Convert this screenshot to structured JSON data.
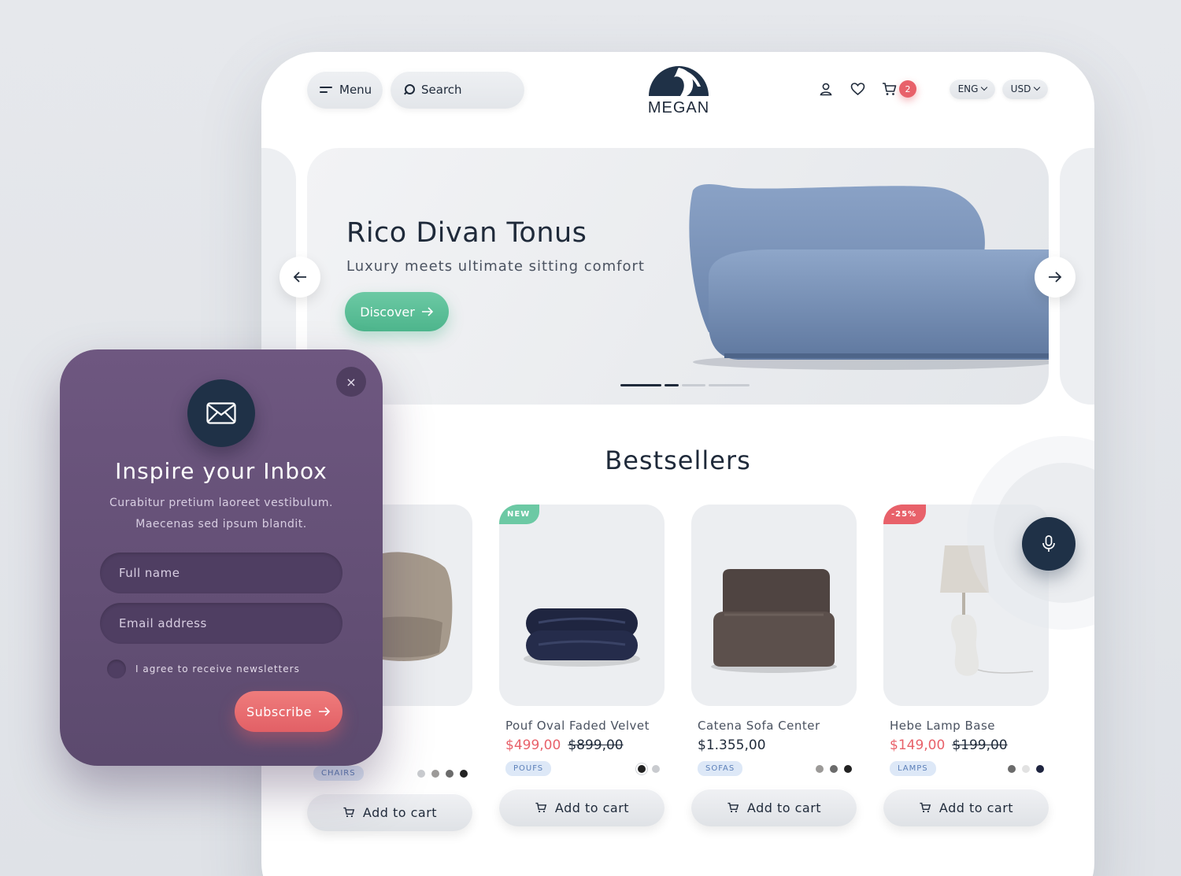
{
  "header": {
    "menu_label": "Menu",
    "search_label": "Search",
    "brand": "MEGAN",
    "cart_count": "2",
    "language": "ENG",
    "currency": "USD"
  },
  "hero": {
    "title": "Rico Divan Tonus",
    "subtitle": "Luxury meets ultimate sitting comfort",
    "cta_label": "Discover",
    "accent_color": "#5cbf97"
  },
  "bestsellers": {
    "title": "Bestsellers",
    "add_to_cart_label": "Add to cart",
    "products": [
      {
        "name": "",
        "price": "",
        "old_price": "",
        "tag": "CHAIRS",
        "badge": ""
      },
      {
        "name": "Pouf Oval Faded Velvet",
        "price": "$499,00",
        "old_price": "$899,00",
        "tag": "POUFS",
        "badge": "NEW"
      },
      {
        "name": "Catena Sofa Center",
        "price": "$1.355,00",
        "old_price": "",
        "tag": "SOFAS",
        "badge": ""
      },
      {
        "name": "Hebe Lamp Base",
        "price": "$149,00",
        "old_price": "$199,00",
        "tag": "LAMPS",
        "badge": "-25%"
      }
    ]
  },
  "newsletter": {
    "title": "Inspire your Inbox",
    "description": "Curabitur pretium laoreet vestibulum. Maecenas sed ipsum blandit.",
    "name_placeholder": "Full name",
    "email_placeholder": "Email address",
    "agree_label": "I agree to receive newsletters",
    "subscribe_label": "Subscribe",
    "close_glyph": "×",
    "background_color": "#654f77",
    "button_color": "#e8666c"
  },
  "icons": {
    "menu": "hamburger-icon",
    "search": "search-icon",
    "account": "user-icon",
    "wishlist": "heart-icon",
    "cart": "cart-icon",
    "voice": "microphone-icon",
    "mail": "envelope-icon"
  }
}
